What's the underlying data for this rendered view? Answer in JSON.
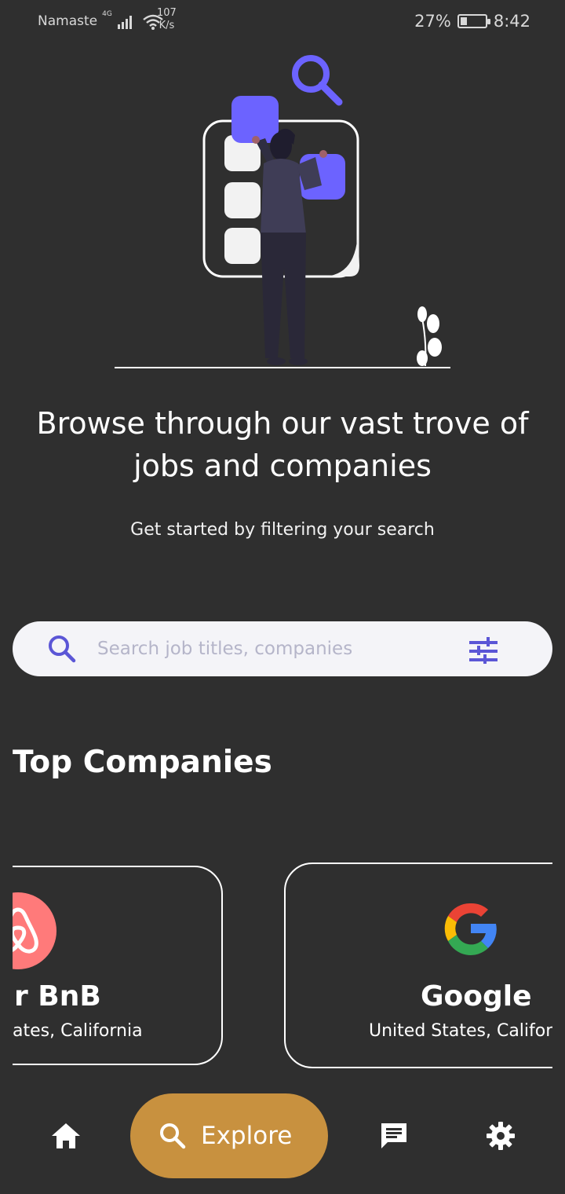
{
  "status_bar": {
    "carrier": "Namaste",
    "network": "4G",
    "speed_value": "107",
    "speed_unit": "K/s",
    "battery": "27%",
    "time": "8:42"
  },
  "hero": {
    "headline": "Browse through our vast trove of jobs and companies",
    "subhead": "Get started by filtering your search"
  },
  "search": {
    "placeholder": "Search job titles, companies"
  },
  "top_companies": {
    "title": "Top Companies",
    "companies": [
      {
        "name": "r BnB",
        "location": "ates, California"
      },
      {
        "name": "Google",
        "location": "United States, Califorr"
      }
    ]
  },
  "nav": {
    "explore_label": "Explore"
  },
  "colors": {
    "background": "#2f2f2f",
    "accent": "#6c63ff",
    "explore": "#c8913f",
    "airbnb": "#ff7a7a"
  }
}
